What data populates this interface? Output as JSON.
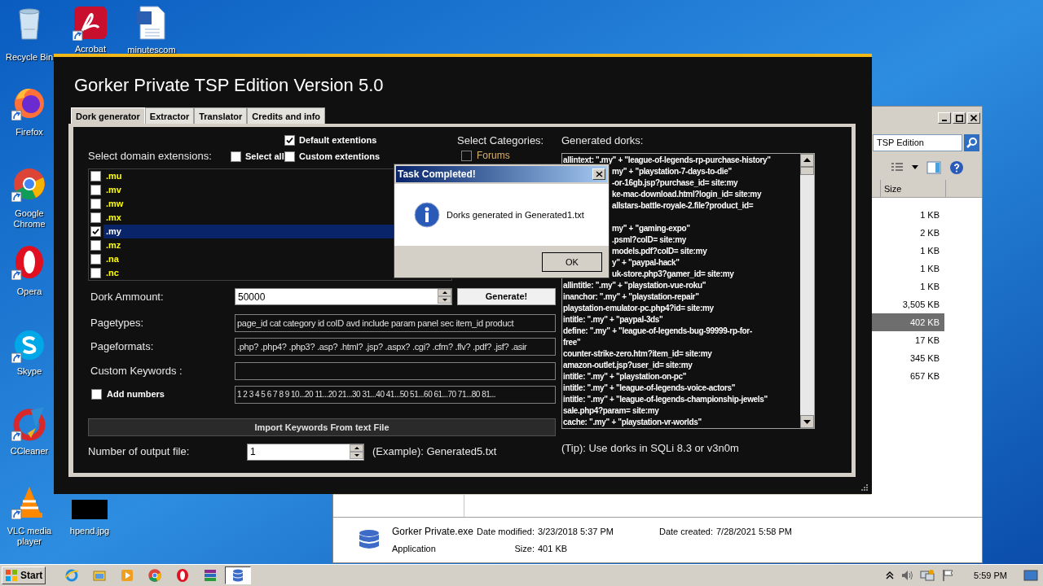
{
  "desktop_icons": [
    {
      "label": "Recycle Bin",
      "kind": "recycle",
      "shortcut": false
    },
    {
      "label": "Acrobat",
      "kind": "acrobat",
      "shortcut": true
    },
    {
      "label": "minutescom",
      "kind": "word",
      "shortcut": false
    },
    {
      "label": "Firefox",
      "kind": "firefox",
      "shortcut": true
    },
    {
      "label": "Google Chrome",
      "kind": "chrome",
      "shortcut": true
    },
    {
      "label": "Opera",
      "kind": "opera",
      "shortcut": true
    },
    {
      "label": "Skype",
      "kind": "skype",
      "shortcut": true
    },
    {
      "label": "CCleaner",
      "kind": "ccleaner",
      "shortcut": true
    },
    {
      "label": "VLC media player",
      "kind": "vlc",
      "shortcut": true
    },
    {
      "label": "hpend.jpg",
      "kind": "image",
      "shortcut": false
    }
  ],
  "explorer": {
    "search_value": "TSP Edition",
    "columns": [
      "Size"
    ],
    "sizes": [
      {
        "text": "1 KB",
        "selected": false
      },
      {
        "text": "2 KB",
        "selected": false
      },
      {
        "text": "1 KB",
        "selected": false
      },
      {
        "text": "1 KB",
        "selected": false
      },
      {
        "text": "1 KB",
        "selected": false
      },
      {
        "text": "3,505 KB",
        "selected": false
      },
      {
        "text": "402 KB",
        "selected": true
      },
      {
        "text": "17 KB",
        "selected": false
      },
      {
        "text": "345 KB",
        "selected": false
      },
      {
        "text": "657 KB",
        "selected": false
      }
    ],
    "details": {
      "name": "Gorker Private.exe",
      "type": "Application",
      "modified_label": "Date modified:",
      "modified": "3/23/2018 5:37 PM",
      "created_label": "Date created:",
      "created": "7/28/2021 5:58 PM",
      "size_label": "Size:",
      "size": "401 KB"
    }
  },
  "main_window": {
    "title": "Gorker Private TSP Edition Version 5.0",
    "tabs": [
      {
        "label": "Dork generator",
        "selected": true
      },
      {
        "label": "Extractor",
        "selected": false
      },
      {
        "label": "Translator",
        "selected": false
      },
      {
        "label": "Credits and info",
        "selected": false
      }
    ],
    "default_extensions": {
      "label": "Default extentions",
      "checked": true
    },
    "domain_label": "Select domain extensions:",
    "select_all": {
      "label": "Select all",
      "checked": false
    },
    "custom_extensions": {
      "label": "Custom extentions",
      "checked": false
    },
    "extensions": [
      {
        "label": ".mu",
        "checked": false,
        "selected": false
      },
      {
        "label": ".mv",
        "checked": false,
        "selected": false
      },
      {
        "label": ".mw",
        "checked": false,
        "selected": false
      },
      {
        "label": ".mx",
        "checked": false,
        "selected": false
      },
      {
        "label": ".my",
        "checked": true,
        "selected": true
      },
      {
        "label": ".mz",
        "checked": false,
        "selected": false
      },
      {
        "label": ".na",
        "checked": false,
        "selected": false
      },
      {
        "label": ".nc",
        "checked": false,
        "selected": false
      }
    ],
    "categories_label": "Select Categories:",
    "categories": [
      {
        "label": "Forums",
        "checked": false
      }
    ],
    "dork_amount": {
      "label": "Dork Ammount:",
      "value": "50000"
    },
    "generate_button": "Generate!",
    "pagetypes": {
      "label": "Pagetypes:",
      "value": "page_id cat category id coID avd include param panel sec item_id product"
    },
    "pageformats": {
      "label": "Pageformats:",
      "value": ".php? .php4? .php3? .asp? .html? .jsp? .aspx? .cgi? .cfm? .flv? .pdf? .jsf? .asir"
    },
    "custom_keywords": {
      "label": "Custom Keywords :"
    },
    "add_numbers": {
      "label": "Add numbers",
      "checked": false,
      "value": "1 2 3 4 5 6 7 8 9 10...20 11...20 21...30 31...40 41...50 51...60 61...70 71...80 81..."
    },
    "import_button": "Import Keywords From text File",
    "output_file": {
      "label": "Number of output file:",
      "value": "1",
      "example": "(Example): Generated5.txt"
    },
    "dorks_label": "Generated dorks:",
    "dorks": [
      {
        "kind": "full",
        "text": "allintext: \".my\" + \"league-of-legends-rp-purchase-history\""
      },
      {
        "kind": "partial",
        "text": "my\" + \"playstation-7-days-to-die\""
      },
      {
        "kind": "partial",
        "text": "-or-16gb.jsp?purchase_id= site:my"
      },
      {
        "kind": "partial",
        "text": "ke-mac-download.html?login_id= site:my"
      },
      {
        "kind": "partial",
        "text": "allstars-battle-royale-2.file?product_id="
      },
      {
        "kind": "blank"
      },
      {
        "kind": "partial",
        "text": "my\" + \"gaming-expo\""
      },
      {
        "kind": "partial",
        "text": ".psml?coID= site:my"
      },
      {
        "kind": "partial",
        "text": "models.pdf?coID= site:my"
      },
      {
        "kind": "partial",
        "text": "y\" + \"paypal-hack\""
      },
      {
        "kind": "partial",
        "text": "uk-store.php3?gamer_id= site:my"
      },
      {
        "kind": "full",
        "text": "allintitle: \".my\" + \"playstation-vue-roku\""
      },
      {
        "kind": "full",
        "text": "inanchor: \".my\" + \"playstation-repair\""
      },
      {
        "kind": "full",
        "text": "playstation-emulator-pc.php4?id= site:my"
      },
      {
        "kind": "full",
        "text": "intitle: \".my\" + \"paypal-3ds\""
      },
      {
        "kind": "full",
        "text": "define: \".my\" + \"league-of-legends-bug-99999-rp-for-"
      },
      {
        "kind": "full",
        "text": "free\""
      },
      {
        "kind": "full",
        "text": "counter-strike-zero.htm?item_id= site:my"
      },
      {
        "kind": "full",
        "text": "amazon-outlet.jsp?user_id= site:my"
      },
      {
        "kind": "full",
        "text": "intitle: \".my\" + \"playstation-on-pc\""
      },
      {
        "kind": "full",
        "text": "intitle: \".my\" + \"league-of-legends-voice-actors\""
      },
      {
        "kind": "full",
        "text": "intitle: \".my\" + \"league-of-legends-championship-jewels\""
      },
      {
        "kind": "full",
        "text": "sale.php4?param= site:my"
      },
      {
        "kind": "full",
        "text": "cache: \".my\" + \"playstation-vr-worlds\""
      }
    ],
    "tip": "(Tip): Use dorks in SQLi 8.3 or v3n0m"
  },
  "dialog": {
    "title": "Task Completed!",
    "message": "Dorks generated in Generated1.txt",
    "ok": "OK"
  },
  "taskbar": {
    "start": "Start",
    "apps": [
      {
        "kind": "ie",
        "active": false
      },
      {
        "kind": "folder",
        "active": false
      },
      {
        "kind": "media",
        "active": false
      },
      {
        "kind": "chrome",
        "active": false
      },
      {
        "kind": "opera",
        "active": false
      },
      {
        "kind": "winrar",
        "active": false
      },
      {
        "kind": "database",
        "active": true
      }
    ],
    "time": "5:59 PM"
  }
}
